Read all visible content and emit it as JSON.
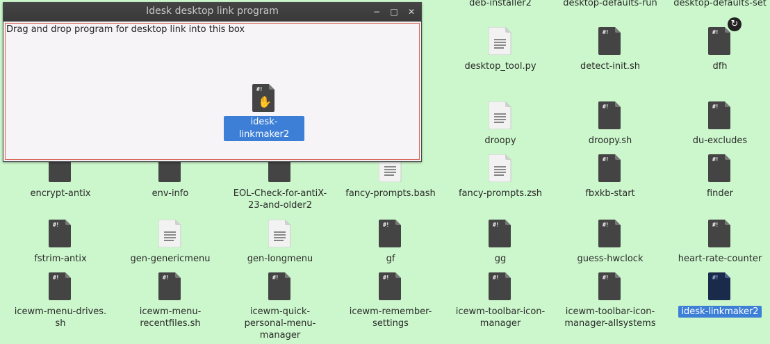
{
  "window": {
    "title": "Idesk desktop link program",
    "instruction": "Drag and drop program for desktop link into this box",
    "dropped_item": {
      "label": "idesk-linkmaker2",
      "icon": "script-file-icon"
    },
    "buttons": {
      "minimize": "−",
      "maximize": "□",
      "close": "✕"
    }
  },
  "desktop": {
    "row0": [
      {
        "label": "deb-installer2"
      },
      {
        "label": "desktop-defaults-run"
      },
      {
        "label": "desktop-defaults-set"
      }
    ],
    "row1": [
      {
        "label": "desktop_tool.py"
      },
      {
        "label": "detect-init.sh"
      },
      {
        "label": "dfh",
        "badge": "↻"
      }
    ],
    "row2": [
      {
        "label": "droopy"
      },
      {
        "label": "droopy.sh"
      },
      {
        "label": "du-excludes"
      }
    ],
    "row3": [
      {
        "label": "encrypt-antix"
      },
      {
        "label": "env-info"
      },
      {
        "label": "EOL-Check-for-antiX-\n23-and-older2"
      },
      {
        "label": "fancy-prompts.bash"
      },
      {
        "label": "fancy-prompts.zsh"
      },
      {
        "label": "fbxkb-start"
      },
      {
        "label": "finder"
      }
    ],
    "row4": [
      {
        "label": "fstrim-antix"
      },
      {
        "label": "gen-genericmenu"
      },
      {
        "label": "gen-longmenu"
      },
      {
        "label": "gf"
      },
      {
        "label": "gg"
      },
      {
        "label": "guess-hwclock"
      },
      {
        "label": "heart-rate-counter"
      }
    ],
    "row5": [
      {
        "label": "icewm-menu-drives.\nsh"
      },
      {
        "label": "icewm-menu-\nrecentfiles.sh"
      },
      {
        "label": "icewm-quick-\npersonal-menu-\nmanager"
      },
      {
        "label": "icewm-remember-\nsettings"
      },
      {
        "label": "icewm-toolbar-icon-\nmanager"
      },
      {
        "label": "icewm-toolbar-icon-\nmanager-allsystems"
      },
      {
        "label": "idesk-linkmaker2"
      }
    ]
  },
  "icons": {
    "script": "script-file-icon",
    "text": "text-file-icon",
    "exec_mark": "#!"
  },
  "colors": {
    "desktop_bg": "#ccf7cc",
    "selection": "#3d7fd6",
    "titlebar": "#3f3f3f",
    "drop_border": "#d96a5a"
  }
}
